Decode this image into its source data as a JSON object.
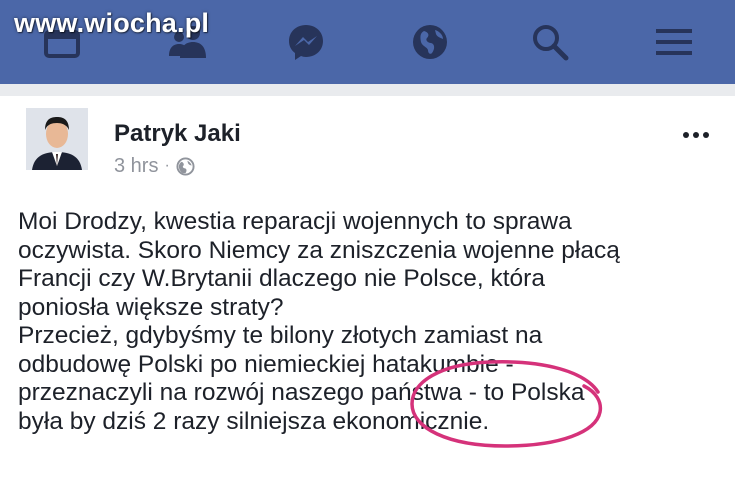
{
  "watermark": "www.wiocha.pl",
  "nav": {
    "icons": [
      "home-feed-icon",
      "friends-icon",
      "messenger-icon",
      "globe-notifications-icon",
      "search-icon",
      "menu-icon"
    ]
  },
  "post": {
    "author": "Patryk Jaki",
    "time": "3 hrs",
    "separator": "·",
    "lines": [
      "Moi Drodzy, kwestia reparacji wojennych to sprawa",
      "oczywista. Skoro Niemcy za zniszczenia wojenne płacą",
      "Francji czy W.Brytanii dlaczego nie Polsce, która",
      "poniosła większe straty?",
      "Przecież, gdybyśmy te bilony złotych zamiast na",
      "odbudowę Polski po niemieckiej hatakumbie -",
      "przeznaczyli na rozwój naszego państwa - to Polska",
      "była by dziś 2 razy silniejsza ekonomicznie."
    ]
  },
  "colors": {
    "navbar": "#4b67a8",
    "nav_icon": "#27345a",
    "text": "#1d2129",
    "meta": "#90949c",
    "annotation": "#d5327a"
  }
}
